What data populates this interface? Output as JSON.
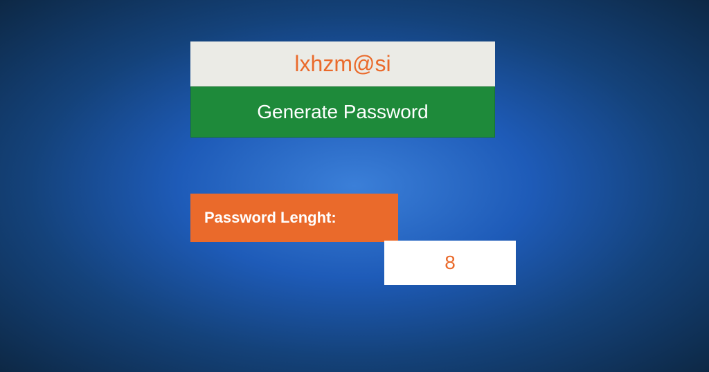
{
  "output": {
    "password": "lxhzm@si"
  },
  "actions": {
    "generate_label": "Generate Password"
  },
  "length": {
    "label": "Password Lenght:",
    "value": "8"
  }
}
